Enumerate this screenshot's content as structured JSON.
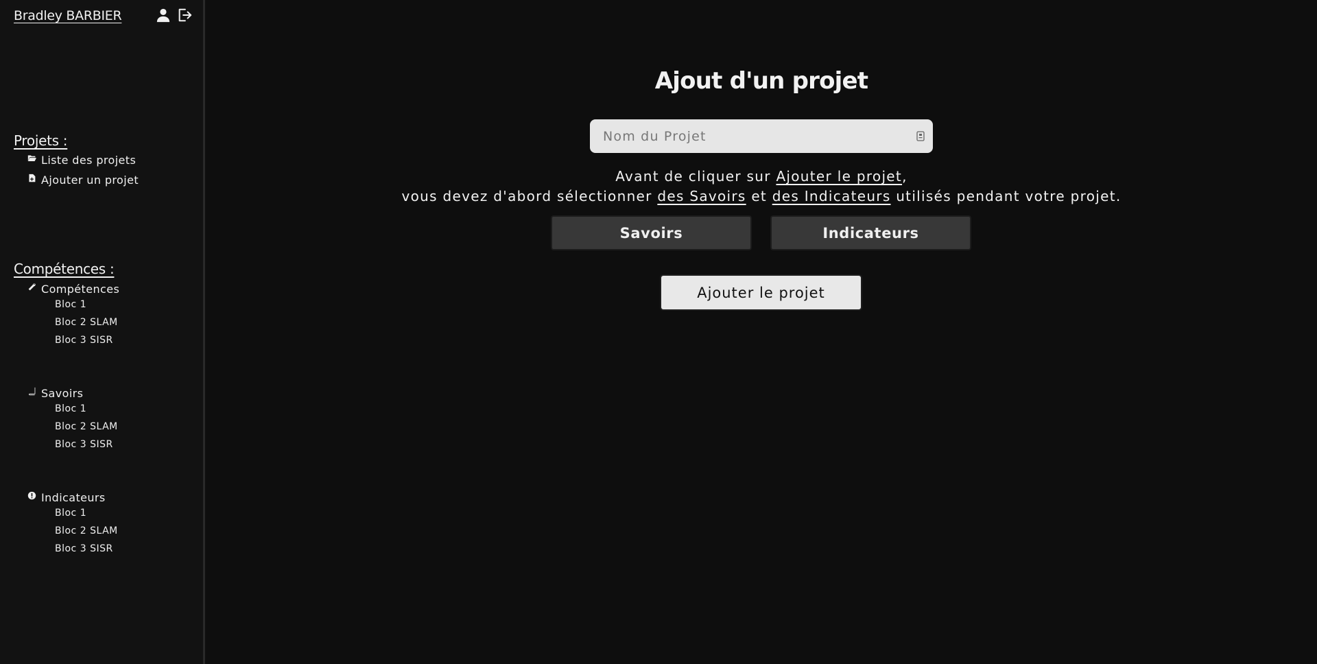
{
  "sidebar": {
    "user_name": "Bradley BARBIER",
    "icons": [
      "user-icon",
      "logout-icon"
    ],
    "projets": {
      "title": "Projets :",
      "items": [
        {
          "label": "Liste des projets",
          "icon": "folder-open-icon"
        },
        {
          "label": "Ajouter un projet",
          "icon": "file-add-icon"
        }
      ]
    },
    "competences": {
      "title": "Compétences :",
      "groups": [
        {
          "label": "Compétences",
          "icon": "wrench-icon",
          "subs": [
            "Bloc 1",
            "Bloc 2 SLAM",
            "Bloc 3 SISR"
          ]
        },
        {
          "label": "Savoirs",
          "icon": "book-icon",
          "subs": [
            "Bloc 1",
            "Bloc 2 SLAM",
            "Bloc 3 SISR"
          ]
        },
        {
          "label": "Indicateurs",
          "icon": "exclamation-circle-icon",
          "subs": [
            "Bloc 1",
            "Bloc 2 SLAM",
            "Bloc 3 SISR"
          ]
        }
      ]
    }
  },
  "main": {
    "title": "Ajout d'un projet",
    "name_input": {
      "placeholder": "Nom du Projet",
      "value": ""
    },
    "info": {
      "line1_pre": "Avant de cliquer sur ",
      "line1_link": "Ajouter le projet",
      "line1_post": ",",
      "line2_pre": "vous devez d'abord sélectionner ",
      "line2_link1": "des Savoirs",
      "line2_mid": " et ",
      "line2_link2": "des Indicateurs",
      "line2_post": " utilisés pendant votre projet."
    },
    "savoirs_button": "Savoirs",
    "indicateurs_button": "Indicateurs",
    "submit_button": "Ajouter le projet"
  },
  "colors": {
    "background": "#0e0e0e",
    "sidebar": "#121212",
    "dark_button": "#383838",
    "light_button": "#e8e8e8",
    "input": "#e6e6e6"
  }
}
